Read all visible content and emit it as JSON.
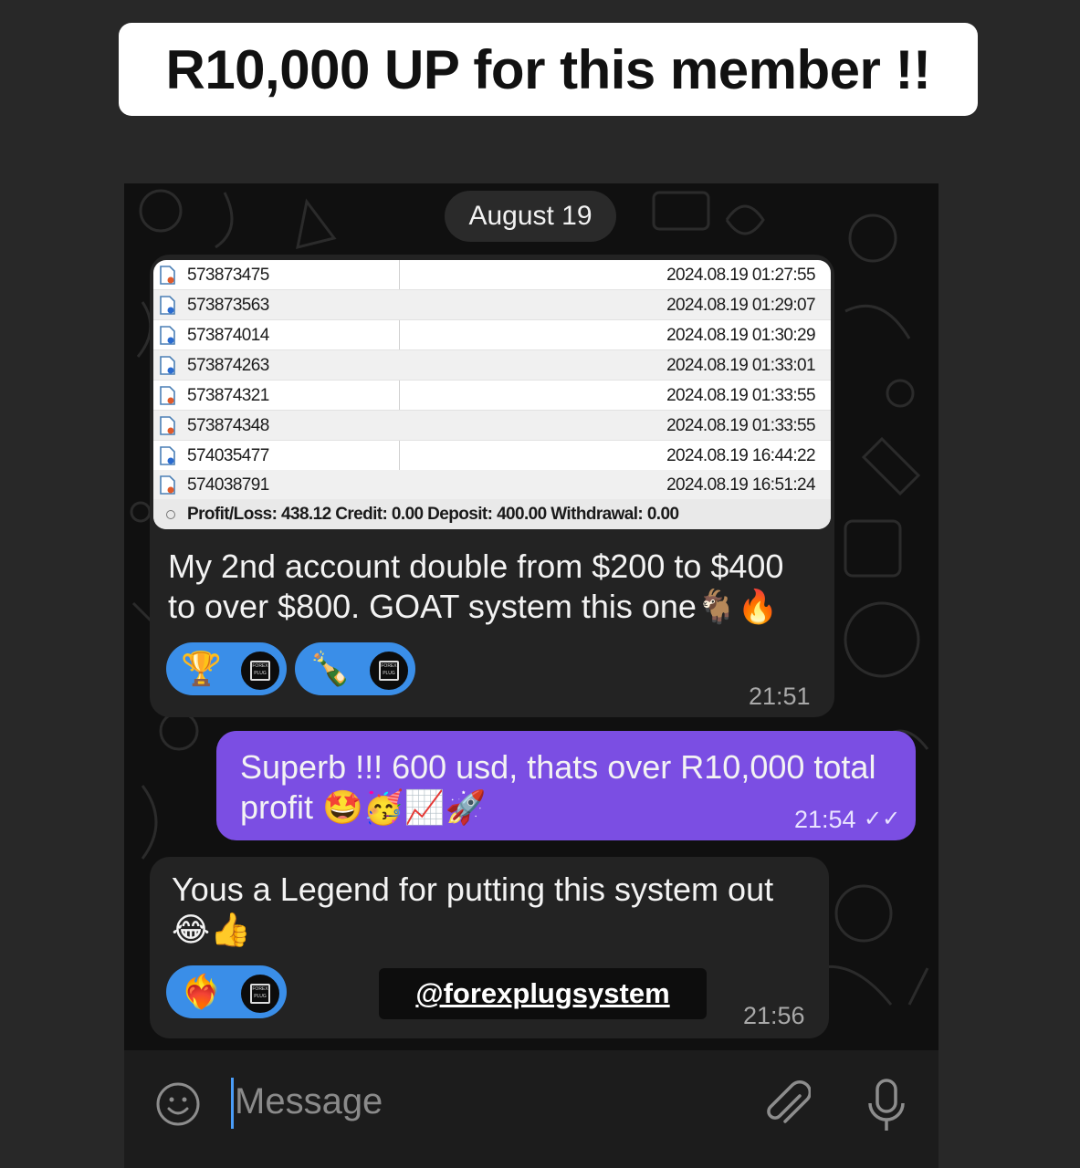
{
  "banner": {
    "text": "R10,000 UP for this member !!"
  },
  "chat": {
    "date": "August 19",
    "screenshot": {
      "rows": [
        {
          "id": "573873475",
          "datetime": "2024.08.19 01:27:55"
        },
        {
          "id": "573873563",
          "datetime": "2024.08.19 01:29:07"
        },
        {
          "id": "573874014",
          "datetime": "2024.08.19 01:30:29"
        },
        {
          "id": "573874263",
          "datetime": "2024.08.19 01:33:01"
        },
        {
          "id": "573874321",
          "datetime": "2024.08.19 01:33:55"
        },
        {
          "id": "573874348",
          "datetime": "2024.08.19 01:33:55"
        },
        {
          "id": "574035477",
          "datetime": "2024.08.19 16:44:22"
        },
        {
          "id": "574038791",
          "datetime": "2024.08.19 16:51:24"
        }
      ],
      "summary": "Profit/Loss: 438.12  Credit: 0.00  Deposit: 400.00  Withdrawal: 0.00"
    },
    "messages": [
      {
        "text_line1": "My 2nd account double from $200 to $400",
        "text_line2": "to over $800. GOAT system this one🐐🔥",
        "time": "21:51",
        "reactions": [
          "🏆",
          "🍾"
        ],
        "reactor_label": "FOREX PLUG"
      },
      {
        "text_line1": "Superb !!! 600 usd, thats over R10,000 total",
        "text_line2": "profit 🤩🥳📈🚀",
        "time": "21:54",
        "status": "✓✓"
      },
      {
        "text_line1": "Yous a Legend for putting this system out",
        "text_line2": "😂👍",
        "time": "21:56",
        "reactions": [
          "❤️‍🔥"
        ],
        "reactor_label": "FOREX PLUG"
      }
    ],
    "watermark": "@forexplugsystem",
    "input": {
      "placeholder": "Message"
    }
  },
  "icons": {
    "smile": "smile-icon",
    "attach": "paperclip-icon",
    "mic": "microphone-icon",
    "doc": "document-icon"
  }
}
